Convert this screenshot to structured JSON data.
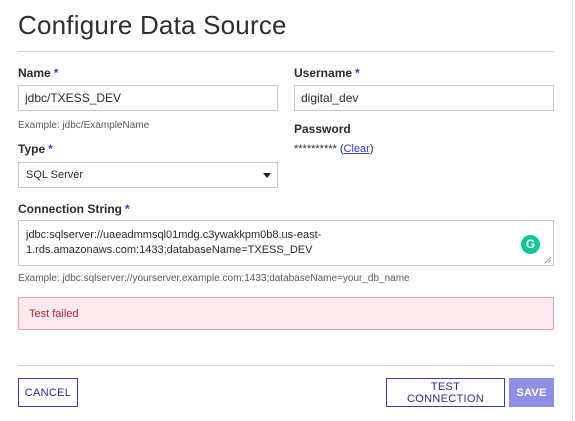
{
  "dialog": {
    "title": "Configure Data Source"
  },
  "name_field": {
    "label": "Name",
    "required_mark": "*",
    "value": "jdbc/TXESS_DEV",
    "hint": "Example: jdbc/ExampleName"
  },
  "username_field": {
    "label": "Username",
    "required_mark": "*",
    "value": "digital_dev"
  },
  "password_field": {
    "label": "Password",
    "masked_value": "**********",
    "clear_open": "(",
    "clear_label": "Clear",
    "clear_close": ")"
  },
  "type_field": {
    "label": "Type",
    "required_mark": "*",
    "selected": "SQL Server"
  },
  "connection_field": {
    "label": "Connection String",
    "required_mark": "*",
    "value": "jdbc:sqlserver://uaeadmmsql01mdg.c3ywakkpm0b8.us-east-1.rds.amazonaws.com:1433;databaseName=TXESS_DEV",
    "hint": "Example: jdbc:sqlserver://yourserver.example.com:1433;databaseName=your_db_name",
    "grammarly_glyph": "G"
  },
  "alert": {
    "message": "Test failed",
    "color": "#b0243b"
  },
  "footer": {
    "cancel_label": "CANCEL",
    "test_label": "TEST CONNECTION",
    "save_label": "SAVE"
  },
  "colors": {
    "accent": "#3a3aa8",
    "save_disabled": "#8f8fe6",
    "error_bg": "#fbe9ec",
    "grammarly": "#15c39a"
  }
}
